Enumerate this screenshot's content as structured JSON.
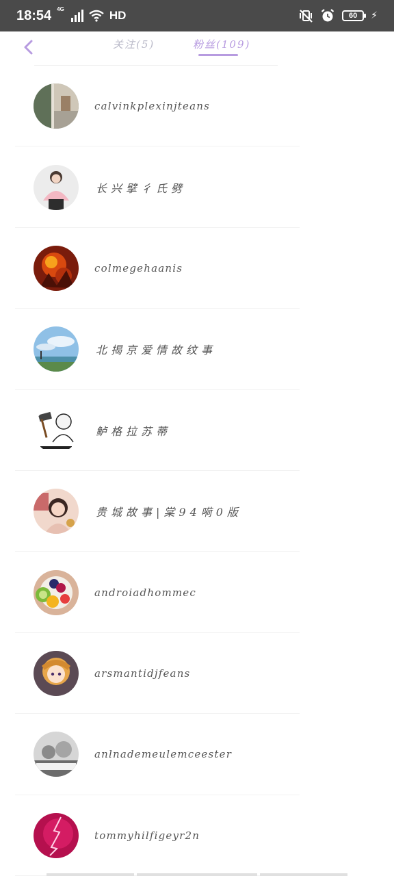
{
  "status_bar": {
    "time": "18:54",
    "network": "4G",
    "hd": "HD",
    "battery": "60",
    "icons": [
      "signal-icon",
      "wifi-icon",
      "mute-vibrate-icon",
      "alarm-icon",
      "battery-icon",
      "charging-icon"
    ]
  },
  "header": {
    "back_icon": "chevron-left-icon",
    "tabs": [
      {
        "label": "关注(5)",
        "active": false
      },
      {
        "label": "粉丝(109)",
        "active": true
      }
    ],
    "accent_color": "#b79be0"
  },
  "fans": [
    {
      "name": "calvinkplexinjteans",
      "avatar": "street-photo-avatar"
    },
    {
      "name": "长兴擘彳氏劈",
      "avatar": "girl-pink-sweater-avatar"
    },
    {
      "name": "colmegehaanis",
      "avatar": "fire-art-avatar"
    },
    {
      "name": "北揭京爱情故纹事",
      "avatar": "sky-landscape-avatar"
    },
    {
      "name": "鲈格拉苏蒂",
      "avatar": "meme-hammer-avatar"
    },
    {
      "name": "贵城故事|棠94嗬0版",
      "avatar": "girl-selfie-avatar"
    },
    {
      "name": "androiadhommec",
      "avatar": "fruit-bowl-avatar"
    },
    {
      "name": "arsmantidjfeans",
      "avatar": "anime-girl-avatar"
    },
    {
      "name": "anlnademeulemceester",
      "avatar": "miss-you-bw-avatar"
    },
    {
      "name": "tommyhilfigeyr2n",
      "avatar": "pink-lightning-avatar"
    }
  ]
}
